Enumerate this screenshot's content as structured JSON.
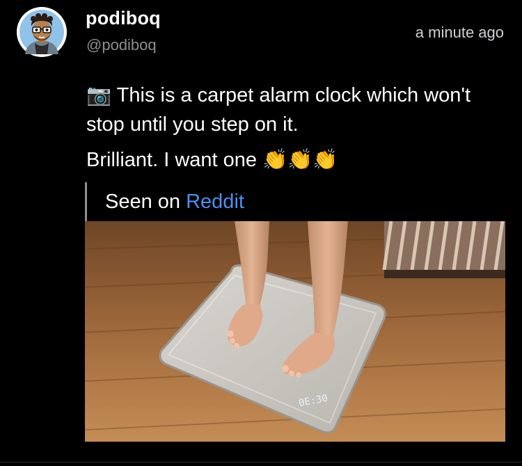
{
  "post": {
    "author": {
      "display_name": "podiboq",
      "handle": "@podiboq"
    },
    "timestamp": "a minute ago",
    "body": {
      "line1_emoji": "📷",
      "line1_text": "This is a carpet alarm clock which won't stop until you step on it.",
      "line2_text": "Brilliant. I want one",
      "line2_emoji": "👏👏👏"
    },
    "source": {
      "prefix": "Seen on",
      "link_text": "Reddit"
    },
    "media": {
      "clock_digits": "0E:30"
    }
  },
  "colors": {
    "background": "#000000",
    "link": "#4d8ff0",
    "secondary_text": "#8e8e93"
  }
}
